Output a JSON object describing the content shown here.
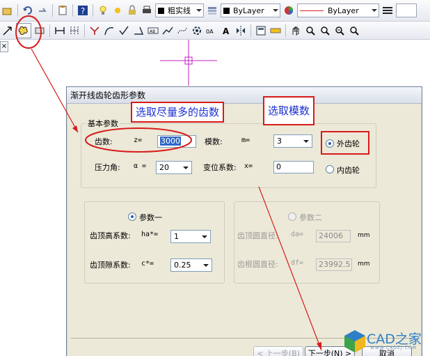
{
  "toolbar_top": {
    "line_weight_label": "粗实线",
    "layer_color": "ByLayer",
    "linetype": "ByLayer"
  },
  "toolbar_bottom": {
    "icons": [
      "move-icon",
      "free-shape-icon",
      "dimension-icon",
      "hatch-icon",
      "line-icon",
      "grid-icon",
      "curve-icon",
      "arc-icon",
      "check-icon",
      "angle-icon",
      "text-icon",
      "polyline-icon",
      "bezier-icon",
      "gear-icon",
      "scale-icon",
      "text-a-icon",
      "mirror-icon",
      "rotate-icon",
      "layer-icon",
      "ruler-icon",
      "pan-icon",
      "zoom-icon",
      "zoom-window-icon",
      "zoom-realtime-icon",
      "zoom-all-icon"
    ]
  },
  "canvas": {
    "close_tab": "×"
  },
  "dialog": {
    "title": "渐开线齿轮齿形参数",
    "basic_group": {
      "label": "基本参数",
      "teeth_label": "齿数:",
      "teeth_symbol": "z=",
      "teeth_value": "3000",
      "module_label": "模数:",
      "module_symbol": "m=",
      "module_value": "3",
      "pressure_label": "压力角:",
      "pressure_symbol": "α =",
      "pressure_value": "20",
      "shift_label": "变位系数:",
      "shift_symbol": "x=",
      "shift_value": "0",
      "external_label": "外齿轮",
      "internal_label": "内齿轮"
    },
    "param1_group": {
      "label": "参数一",
      "addendum_label": "齿顶高系数:",
      "addendum_symbol": "ha*=",
      "addendum_value": "1",
      "clearance_label": "齿顶隙系数:",
      "clearance_symbol": "c*=",
      "clearance_value": "0.25"
    },
    "param2_group": {
      "label": "参数二",
      "tip_diameter_label": "齿顶圆直径:",
      "tip_diameter_symbol": "da=",
      "tip_diameter_value": "24006",
      "tip_unit": "mm",
      "root_diameter_label": "齿根圆直径:",
      "root_diameter_symbol": "df=",
      "root_diameter_value": "23992.5",
      "root_unit": "mm"
    },
    "buttons": {
      "prev": "< 上一步(B)",
      "next": "下一步(N) >",
      "cancel": "取消"
    }
  },
  "annotations": {
    "teeth_note": "选取尽量多的齿数",
    "module_note": "选取模数",
    "highlight_color": "#d71a1a"
  },
  "watermark": {
    "brand": "CAD之家",
    "url": "WWW.CADZJ.COM"
  }
}
